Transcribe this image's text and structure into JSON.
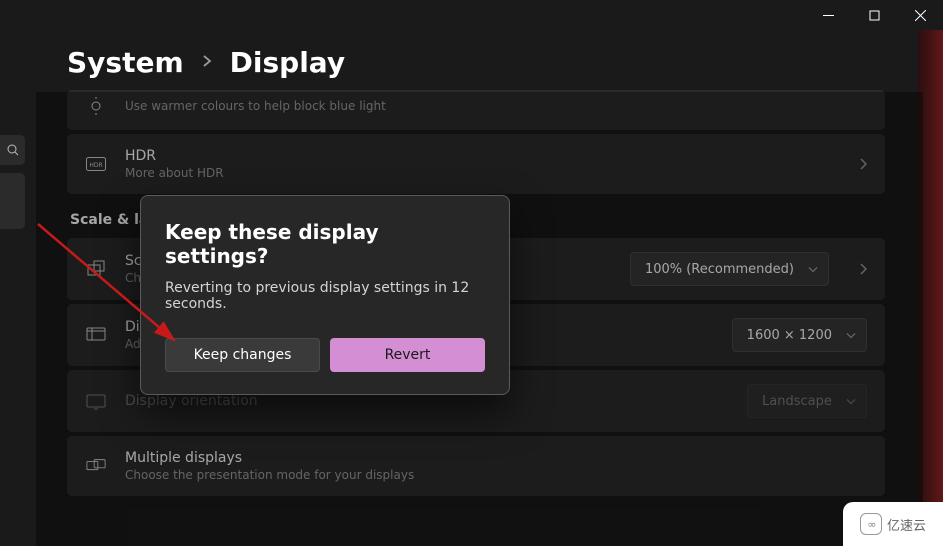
{
  "titlebar": {
    "min": "minimize",
    "max": "maximize",
    "close": "close"
  },
  "breadcrumb": {
    "system": "System",
    "display": "Display"
  },
  "cards": {
    "nightlight_sub": "Use warmer colours to help block blue light",
    "hdr_title": "HDR",
    "hdr_sub": "More about HDR",
    "scale_title": "Scale",
    "scale_sub": "Change the size of text, apps, and other items",
    "scale_value": "100% (Recommended)",
    "res_title": "Display resolution",
    "res_sub": "Adjust the resolution to fit your connected display",
    "res_value": "1600 × 1200",
    "orient_title": "Display orientation",
    "orient_value": "Landscape",
    "multi_title": "Multiple displays",
    "multi_sub": "Choose the presentation mode for your displays"
  },
  "section": {
    "scale_layout": "Scale & layout"
  },
  "dialog": {
    "title": "Keep these display settings?",
    "message": "Reverting to previous display settings in 12 seconds.",
    "keep": "Keep changes",
    "revert": "Revert"
  },
  "watermark": {
    "text": "亿速云"
  }
}
